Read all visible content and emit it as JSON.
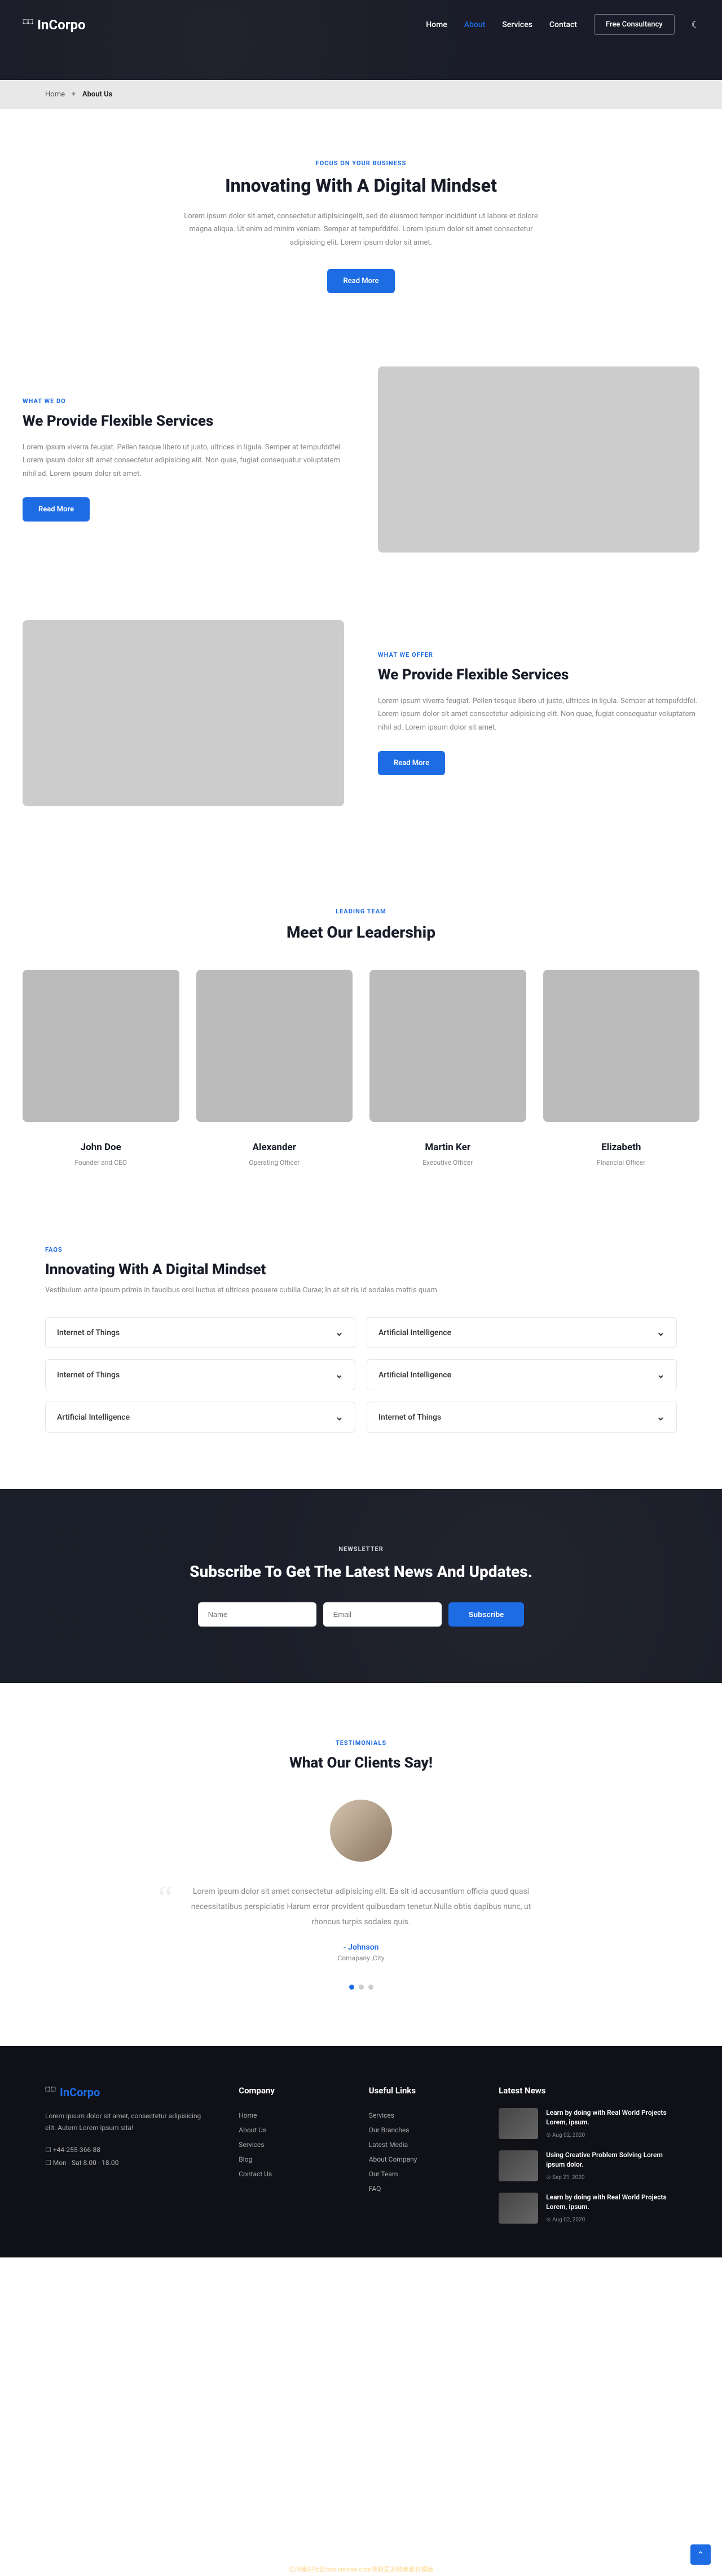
{
  "brand": "InCorpo",
  "nav": {
    "home": "Home",
    "about": "About",
    "services": "Services",
    "contact": "Contact",
    "cta": "Free Consultancy"
  },
  "breadcrumb": {
    "home": "Home",
    "current": "About Us"
  },
  "hero": {
    "eyebrow": "FOCUS ON YOUR BUSINESS",
    "title": "Innovating With A Digital Mindset",
    "body": "Lorem ipsum dolor sit amet, consectetur adipisicingelit, sed do eiusmod tempor incididunt ut labore et dolore magna aliqua. Ut enim ad minim veniam. Semper at tempufddfel. Lorem ipsum dolor sit amet consectetur adipisicing elit. Lorem ipsum dolor sit amet.",
    "btn": "Read More"
  },
  "what_we_do": {
    "eyebrow": "WHAT WE DO",
    "title": "We Provide Flexible Services",
    "body": "Lorem ipsum viverra feugiat. Pellen tesque libero ut justo, ultrices in ligula. Semper at tempufddfel. Lorem ipsum dolor sit amet consectetur adipisicing elit. Non quae, fugiat consequatur voluptatem nihil ad. Lorem ipsum dolor sit amet.",
    "btn": "Read More"
  },
  "what_we_offer": {
    "eyebrow": "WHAT WE OFFER",
    "title": "We Provide Flexible Services",
    "body": "Lorem ipsum viverra feugiat. Pellen tesque libero ut justo, ultrices in ligula. Semper at tempufddfel. Lorem ipsum dolor sit amet consectetur adipisicing elit. Non quae, fugiat consequatur voluptatem nihil ad. Lorem ipsum dolor sit amet.",
    "btn": "Read More"
  },
  "team": {
    "eyebrow": "LEADING TEAM",
    "title": "Meet Our Leadership",
    "members": [
      {
        "name": "John Doe",
        "role": "Founder and CEO"
      },
      {
        "name": "Alexander",
        "role": "Operating Officer"
      },
      {
        "name": "Martin Ker",
        "role": "Executive Officer"
      },
      {
        "name": "Elizabeth",
        "role": "Financial Officer"
      }
    ]
  },
  "faq": {
    "eyebrow": "FAQS",
    "title": "Innovating With A Digital Mindset",
    "body": "Vestibulum ante ipsum primis in faucibus orci luctus et ultrices posuere cubilia Curae; In at sit ris id sodales mattis quam.",
    "items": [
      "Internet of Things",
      "Artificial Intelligence",
      "Internet of Things",
      "Artificial Intelligence",
      "Artificial Intelligence",
      "Internet of Things"
    ]
  },
  "newsletter": {
    "eyebrow": "NEWSLETTER",
    "title": "Subscribe To Get The Latest News And Updates.",
    "name_ph": "Name",
    "email_ph": "Email",
    "btn": "Subscribe"
  },
  "testimonials": {
    "eyebrow": "TESTIMONIALS",
    "title": "What Our Clients Say!",
    "quote": "Lorem ipsum dolor sit amet consectetur adipisicing elit. Ea sit id accusantium officia quod quasi necessitatibus perspiciatis Harum error provident quibusdam tenetur.Nulla obtis dapibus nunc, ut rhoncus turpis sodales quis.",
    "author": "- Johnson",
    "author_sub": "Comapany ,City"
  },
  "footer": {
    "about": "Lorem ipsum dolor sit amet, consectetur adipisicing elit. Autem Lorem ipsum sita!",
    "phone": "+44-255-366-88",
    "hours": "Mon - Sat 8.00 - 18.00",
    "company": {
      "h": "Company",
      "links": [
        "Home",
        "About Us",
        "Services",
        "Blog",
        "Contact Us"
      ]
    },
    "useful": {
      "h": "Useful Links",
      "links": [
        "Services",
        "Our Branches",
        "Latest Media",
        "About Company",
        "Our Team",
        "FAQ"
      ]
    },
    "news": {
      "h": "Latest News",
      "items": [
        {
          "t": "Learn by doing with Real World Projects Lorem, ipsum.",
          "d": "Aug 02, 2020"
        },
        {
          "t": "Using Creative Problem Solving Lorem ipsum dolor.",
          "d": "Sep 21, 2020"
        },
        {
          "t": "Learn by doing with Real World Projects Lorem, ipsum.",
          "d": "Aug 02, 2020"
        }
      ]
    }
  },
  "watermark": "访问素材社区bbs.xienlao.com获取更多精美素材模板"
}
